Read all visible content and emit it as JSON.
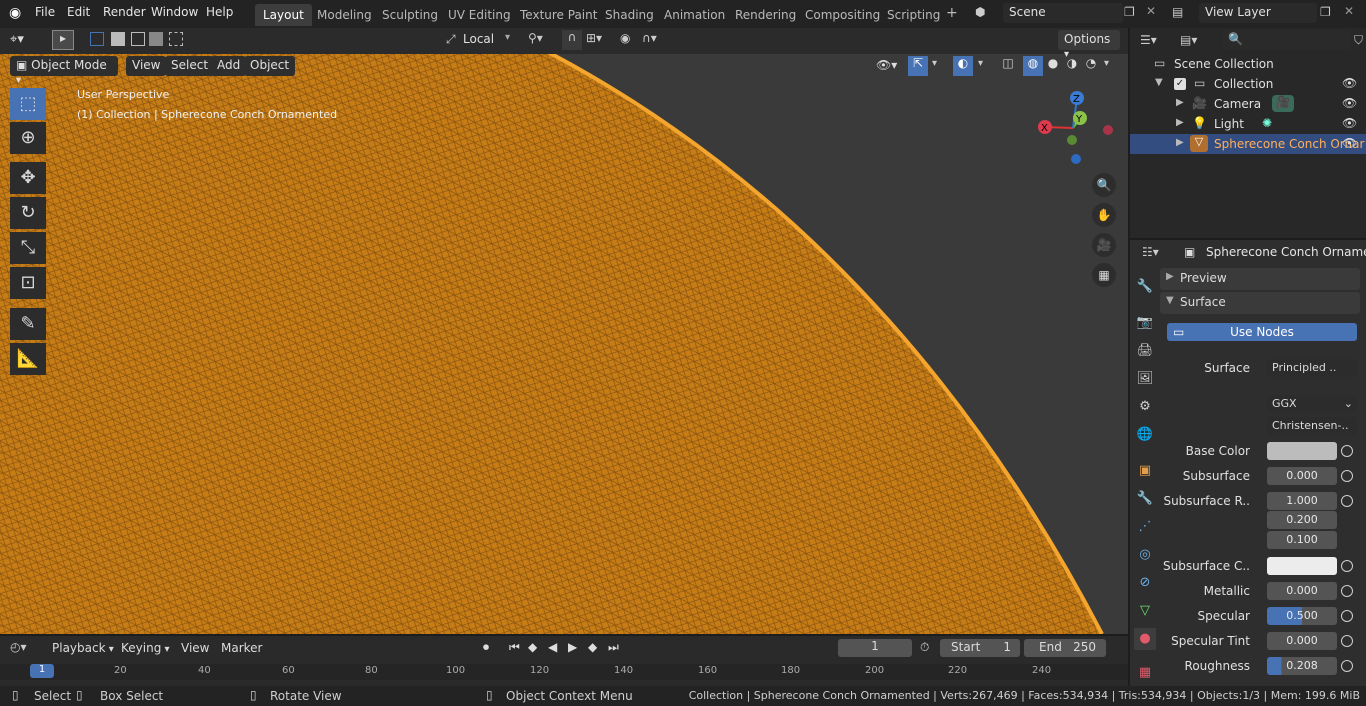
{
  "menu": [
    "File",
    "Edit",
    "Render",
    "Window",
    "Help"
  ],
  "workspaces": [
    "Layout",
    "Modeling",
    "Sculpting",
    "UV Editing",
    "Texture Paint",
    "Shading",
    "Animation",
    "Rendering",
    "Compositing",
    "Scripting"
  ],
  "active_workspace": "Layout",
  "scene_name": "Scene",
  "view_layer": "View Layer",
  "toolbar": {
    "transform_orientation": "Local",
    "options_label": "Options"
  },
  "viewport_header": {
    "mode": "Object Mode",
    "menus": [
      "View",
      "Select",
      "Add",
      "Object"
    ]
  },
  "viewport_overlay": {
    "perspective": "User Perspective",
    "collection_info": "(1) Collection | Spherecone Conch Ornamented"
  },
  "gizmo": {
    "x": "X",
    "y": "Y",
    "z": "Z"
  },
  "outliner": {
    "root": "Scene Collection",
    "items": [
      {
        "label": "Collection"
      },
      {
        "label": "Camera"
      },
      {
        "label": "Light"
      },
      {
        "label": "Spherecone Conch Ornar"
      }
    ]
  },
  "properties": {
    "object_name": "Spherecone Conch Ornamented",
    "preview_label": "Preview",
    "surface_label": "Surface",
    "use_nodes": "Use Nodes",
    "surface_field_label": "Surface",
    "surface_value": "Principled ..",
    "distribution": "GGX",
    "subsurface_method": "Christensen-..",
    "fields": [
      {
        "label": "Base Color",
        "value": ""
      },
      {
        "label": "Subsurface",
        "value": "0.000"
      },
      {
        "label": "Subsurface R..",
        "value": "1.000"
      },
      {
        "label": "",
        "value": "0.200"
      },
      {
        "label": "",
        "value": "0.100"
      },
      {
        "label": "Subsurface C..",
        "value": ""
      },
      {
        "label": "Metallic",
        "value": "0.000"
      },
      {
        "label": "Specular",
        "value": "0.500"
      },
      {
        "label": "Specular Tint",
        "value": "0.000"
      },
      {
        "label": "Roughness",
        "value": "0.208"
      }
    ]
  },
  "timeline": {
    "menus": [
      "Playback",
      "Keying",
      "View",
      "Marker"
    ],
    "current_frame": "1",
    "start_label": "Start",
    "start": "1",
    "end_label": "End",
    "end": "250",
    "ticks": [
      "20",
      "40",
      "60",
      "80",
      "100",
      "120",
      "140",
      "160",
      "180",
      "200",
      "220",
      "240"
    ],
    "playhead": "1"
  },
  "statusbar": {
    "select": "Select",
    "box_select": "Box Select",
    "rotate_view": "Rotate View",
    "context_menu": "Object Context Menu",
    "stats": "Collection | Spherecone Conch Ornamented | Verts:267,469 | Faces:534,934 | Tris:534,934 | Objects:1/3 | Mem: 199.6 MiB"
  },
  "colors": {
    "accent": "#4772b3",
    "mesh": "#d98a1e",
    "selected_row": "#334d80"
  }
}
